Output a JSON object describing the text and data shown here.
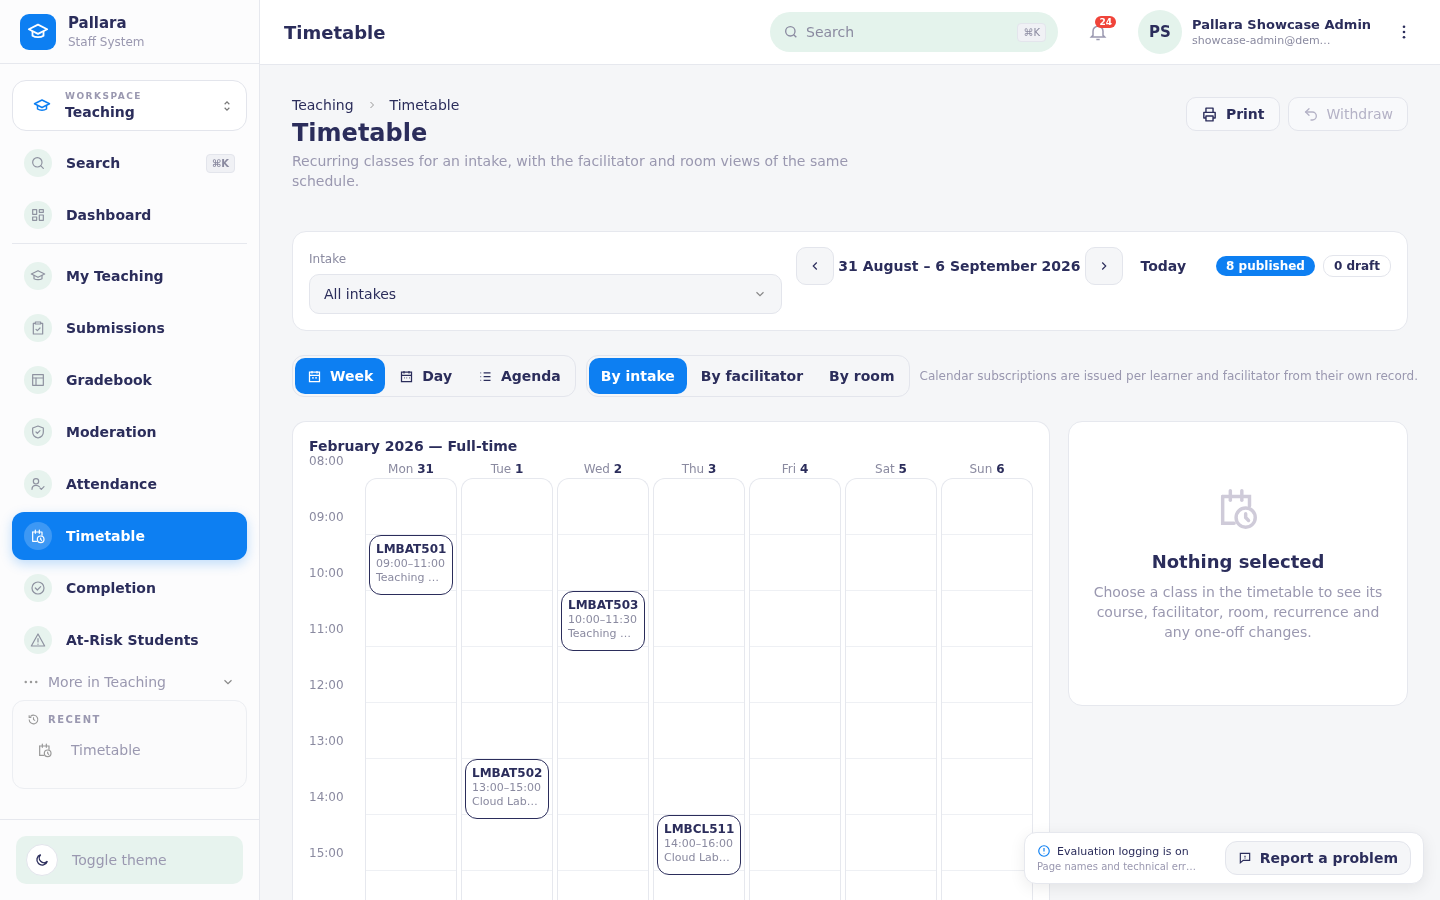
{
  "brand": {
    "name": "Pallara",
    "subtitle": "Staff System"
  },
  "workspace": {
    "label": "WORKSPACE",
    "value": "Teaching"
  },
  "sidebar": {
    "top_items": [
      {
        "label": "Search",
        "shortcut": "⌘K",
        "selected": false
      },
      {
        "label": "Dashboard",
        "selected": false
      }
    ],
    "items": [
      {
        "label": "My Teaching",
        "selected": false
      },
      {
        "label": "Submissions",
        "selected": false
      },
      {
        "label": "Gradebook",
        "selected": false
      },
      {
        "label": "Moderation",
        "selected": false
      },
      {
        "label": "Attendance",
        "selected": false
      },
      {
        "label": "Timetable",
        "selected": true
      },
      {
        "label": "Completion",
        "selected": false
      },
      {
        "label": "At-Risk Students",
        "selected": false
      }
    ],
    "more": "More in Teaching",
    "recent": {
      "title": "RECENT",
      "items": [
        "Timetable"
      ]
    },
    "toggle_theme": "Toggle theme"
  },
  "topbar": {
    "title": "Timetable",
    "search": {
      "placeholder": "Search",
      "shortcut": "⌘K"
    },
    "notifications": "24",
    "user": {
      "initials": "PS",
      "name": "Pallara Showcase Admin",
      "email": "showcase-admin@dem…"
    }
  },
  "page": {
    "breadcrumb": [
      "Teaching",
      "Timetable"
    ],
    "title": "Timetable",
    "description": "Recurring classes for an intake, with the facilitator and room views of the same schedule.",
    "actions": [
      {
        "label": "Print",
        "disabled": false
      },
      {
        "label": "Withdraw",
        "disabled": true
      }
    ]
  },
  "filters": {
    "intake_label": "Intake",
    "intake_value": "All intakes",
    "range": "31 August – 6 September 2026",
    "today": "Today",
    "badges": [
      {
        "label": "8 published",
        "kind": "published"
      },
      {
        "label": "0 draft",
        "kind": "draft"
      }
    ]
  },
  "view_tabs": [
    {
      "label": "Week",
      "selected": true
    },
    {
      "label": "Day",
      "selected": false
    },
    {
      "label": "Agenda",
      "selected": false
    }
  ],
  "group_tabs": [
    {
      "label": "By intake",
      "selected": true
    },
    {
      "label": "By facilitator",
      "selected": false
    },
    {
      "label": "By room",
      "selected": false
    }
  ],
  "note": "Calendar subscriptions are issued per learner and facilitator from their own record.",
  "calendar": {
    "title": "February 2026 — Full-time",
    "hours": [
      "08:00",
      "09:00",
      "10:00",
      "11:00",
      "12:00",
      "13:00",
      "14:00",
      "15:00"
    ],
    "days": [
      {
        "name": "Mon",
        "date": "31",
        "events": [
          {
            "code": "LMBAT501",
            "time": "09:00–11:00",
            "detail": "Teaching …"
          }
        ]
      },
      {
        "name": "Tue",
        "date": "1",
        "events": [
          {
            "code": "LMBAT502",
            "time": "13:00–15:00",
            "detail": "Cloud Lab…"
          }
        ]
      },
      {
        "name": "Wed",
        "date": "2",
        "events": [
          {
            "code": "LMBAT503",
            "time": "10:00–11:30",
            "detail": "Teaching …"
          }
        ]
      },
      {
        "name": "Thu",
        "date": "3",
        "events": [
          {
            "code": "LMBCL511",
            "time": "14:00–16:00",
            "detail": "Cloud Lab…"
          }
        ]
      },
      {
        "name": "Fri",
        "date": "4"
      },
      {
        "name": "Sat",
        "date": "5"
      },
      {
        "name": "Sun",
        "date": "6"
      }
    ]
  },
  "detail": {
    "title": "Nothing selected",
    "text": "Choose a class in the timetable to see its course, facilitator, room, recurrence and any one-off changes."
  },
  "toast": {
    "title": "Evaluation logging is on",
    "text": "Page names and technical err…",
    "button": "Report a problem"
  }
}
